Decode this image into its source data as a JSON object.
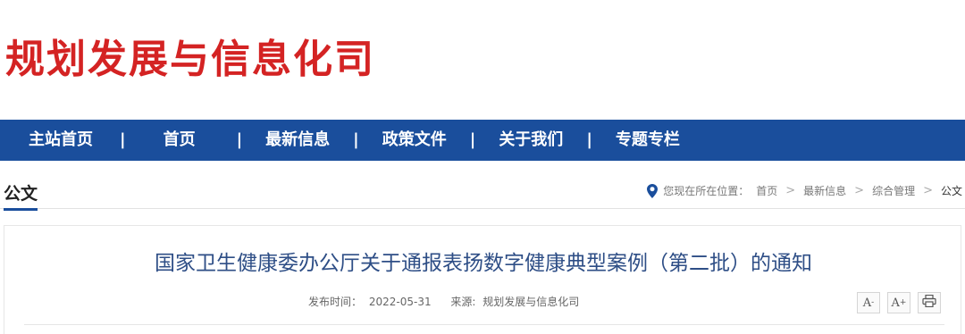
{
  "brand": {
    "title": "规划发展与信息化司",
    "color": "#d42323"
  },
  "navbar": {
    "background": "#1a4e9c",
    "items": [
      {
        "label": "主站首页"
      },
      {
        "label": "首页"
      },
      {
        "label": "最新信息"
      },
      {
        "label": "政策文件"
      },
      {
        "label": "关于我们"
      },
      {
        "label": "专题专栏"
      }
    ],
    "separator": "|"
  },
  "section": {
    "title": "公文"
  },
  "breadcrumb": {
    "icon": "location-pin-icon",
    "prefix": "您现在所在位置：",
    "items": [
      "首页",
      "最新信息",
      "综合管理",
      "公文"
    ],
    "arrow": ">"
  },
  "article": {
    "title": "国家卫生健康委办公厅关于通报表扬数字健康典型案例（第二批）的通知",
    "publish_label": "发布时间：",
    "publish_date": "2022-05-31",
    "source_label": "来源:",
    "source": "规划发展与信息化司"
  },
  "tools": {
    "font_decrease": {
      "label": "A",
      "sup": "-"
    },
    "font_increase": {
      "label": "A",
      "sup": "+"
    },
    "print_icon": "printer-icon"
  }
}
